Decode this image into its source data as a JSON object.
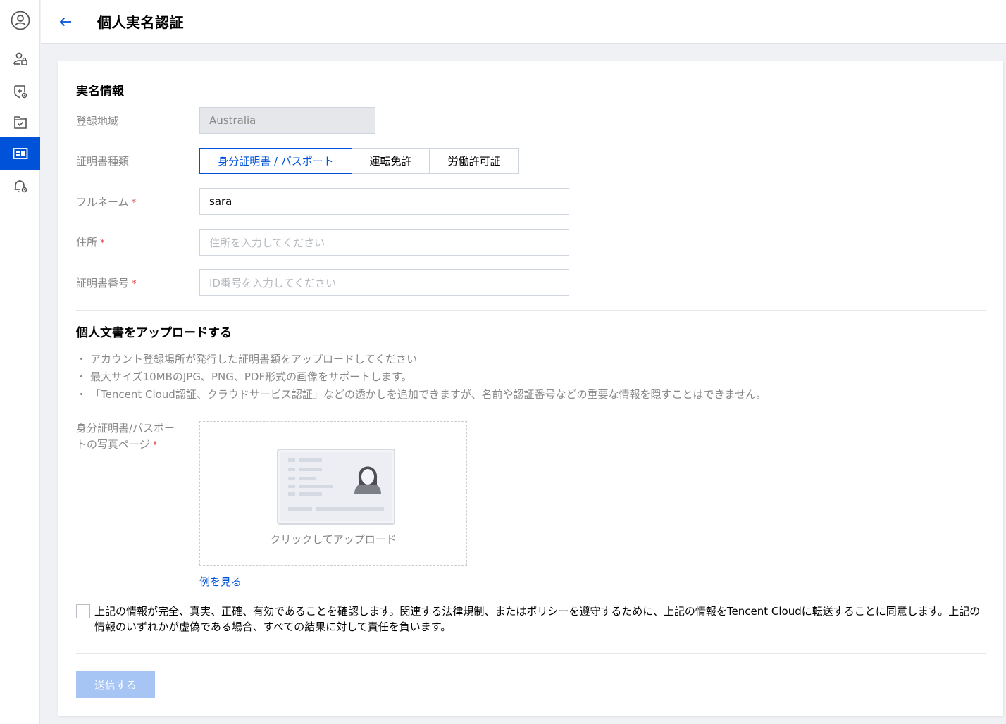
{
  "sidebar": {
    "items": [
      {
        "icon": "account-circle-icon"
      },
      {
        "icon": "user-lock-icon"
      },
      {
        "icon": "shield-settings-icon"
      },
      {
        "icon": "folder-check-icon"
      },
      {
        "icon": "id-card-icon",
        "active": true
      },
      {
        "icon": "bell-settings-icon"
      }
    ]
  },
  "header": {
    "title": "個人実名認証",
    "back_icon": "arrow-left-icon"
  },
  "section_info": {
    "title": "実名情報",
    "region_label": "登録地域",
    "region_value": "Australia",
    "doc_type_label": "証明書種類",
    "doc_types": [
      "身分証明書 / パスポート",
      "運転免許",
      "労働許可証"
    ],
    "doc_type_selected": 0,
    "fullname_label": "フルネーム",
    "fullname_value": "sara",
    "address_label": "住所",
    "address_placeholder": "住所を入力してください",
    "idno_label": "証明書番号",
    "idno_placeholder": "ID番号を入力してください",
    "required_mark": "*"
  },
  "section_upload": {
    "title": "個人文書をアップロードする",
    "tips": [
      "アカウント登録場所が発行した証明書類をアップロードしてください",
      "最大サイズ10MBのJPG、PNG、PDF形式の画像をサポートします。",
      "「Tencent Cloud認証、クラウドサービス認証」などの透かしを追加できますが、名前や認証番号などの重要な情報を隠すことはできません。"
    ],
    "bullet": "・",
    "photo_label": "身分証明書/パスポートの写真ページ",
    "upload_hint": "クリックしてアップロード",
    "example_link": "例を見る"
  },
  "agreement": {
    "text": "上記の情報が完全、真実、正確、有効であることを確認します。関連する法律規制、またはポリシーを遵守するために、上記の情報をTencent Cloudに転送することに同意します。上記の情報のいずれかが虚偽である場合、すべての結果に対して責任を負います。",
    "checked": false
  },
  "submit_label": "送信する",
  "colors": {
    "brand": "#0052d9",
    "required": "#e54545",
    "submit_disabled": "#a6c5f5"
  }
}
